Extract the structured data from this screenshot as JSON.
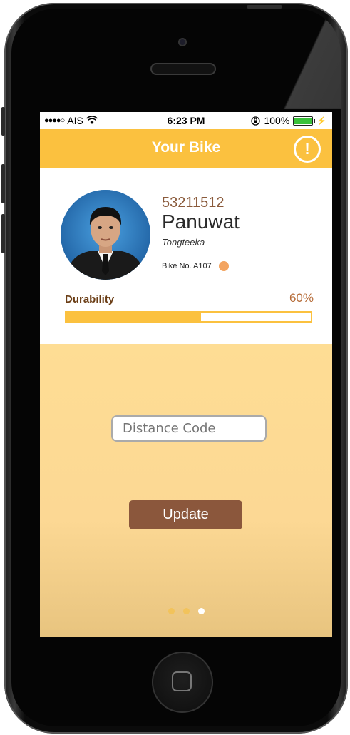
{
  "status_bar": {
    "signal": "●●●●○",
    "carrier": "AIS",
    "wifi_icon": "wifi-icon",
    "time": "6:23 PM",
    "lock_icon": "rotation-lock-icon",
    "battery_percent": "100%",
    "battery_level": 1.0
  },
  "navbar": {
    "title": "Your Bike",
    "alert_icon": "!"
  },
  "profile": {
    "student_id": "53211512",
    "first_name": "Panuwat",
    "last_name": "Tongteeka",
    "bike_no": "Bike No. A107",
    "status_color": "#f3a460"
  },
  "durability": {
    "label": "Durability",
    "value_text": "60%",
    "value": 0.55
  },
  "form": {
    "distance_placeholder": "Distance Code",
    "update_label": "Update"
  },
  "pager": {
    "count": 3,
    "active_index": 2
  },
  "colors": {
    "accent": "#fbc13f",
    "button": "#8b573c",
    "background": "#fedd94"
  }
}
